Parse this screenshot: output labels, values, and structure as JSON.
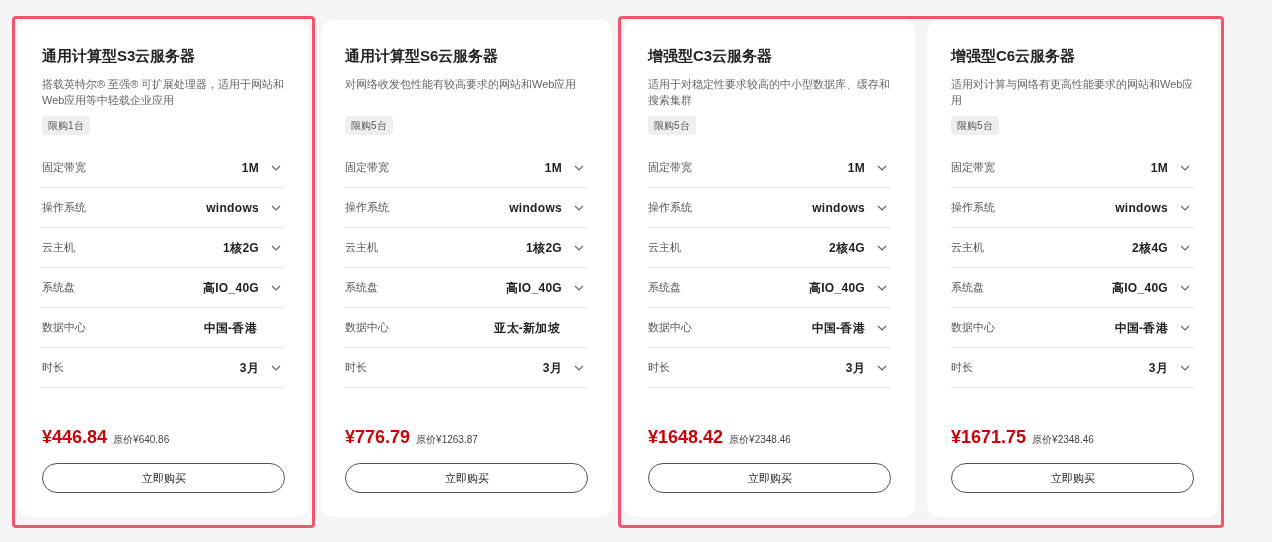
{
  "groups": [
    {
      "highlighted": true,
      "cards": [
        {
          "title": "通用计算型S3云服务器",
          "description": "搭载英特尔® 至强® 可扩展处理器，适用于网站和Web应用等中轻载企业应用",
          "limit": "限购1台",
          "specs": [
            {
              "label": "固定带宽",
              "value": "1M",
              "dropdown": true
            },
            {
              "label": "操作系统",
              "value": "windows",
              "dropdown": true
            },
            {
              "label": "云主机",
              "value": "1核2G",
              "dropdown": true
            },
            {
              "label": "系统盘",
              "value": "高IO_40G",
              "dropdown": true
            },
            {
              "label": "数据中心",
              "value": "中国-香港",
              "dropdown": false
            },
            {
              "label": "时长",
              "value": "3月",
              "dropdown": true
            }
          ],
          "price": "¥446.84",
          "original_price": "原价¥640.86",
          "button": "立即购买"
        }
      ]
    },
    {
      "highlighted": false,
      "cards": [
        {
          "title": "通用计算型S6云服务器",
          "description": "对网络收发包性能有较高要求的网站和Web应用",
          "limit": "限购5台",
          "specs": [
            {
              "label": "固定带宽",
              "value": "1M",
              "dropdown": true
            },
            {
              "label": "操作系统",
              "value": "windows",
              "dropdown": true
            },
            {
              "label": "云主机",
              "value": "1核2G",
              "dropdown": true
            },
            {
              "label": "系统盘",
              "value": "高IO_40G",
              "dropdown": true
            },
            {
              "label": "数据中心",
              "value": "亚太-新加坡",
              "dropdown": false
            },
            {
              "label": "时长",
              "value": "3月",
              "dropdown": true
            }
          ],
          "price": "¥776.79",
          "original_price": "原价¥1263.87",
          "button": "立即购买"
        }
      ]
    },
    {
      "highlighted": true,
      "cards": [
        {
          "title": "增强型C3云服务器",
          "description": "适用于对稳定性要求较高的中小型数据库、缓存和搜索集群",
          "limit": "限购5台",
          "specs": [
            {
              "label": "固定带宽",
              "value": "1M",
              "dropdown": true
            },
            {
              "label": "操作系统",
              "value": "windows",
              "dropdown": true
            },
            {
              "label": "云主机",
              "value": "2核4G",
              "dropdown": true
            },
            {
              "label": "系统盘",
              "value": "高IO_40G",
              "dropdown": true
            },
            {
              "label": "数据中心",
              "value": "中国-香港",
              "dropdown": true
            },
            {
              "label": "时长",
              "value": "3月",
              "dropdown": true
            }
          ],
          "price": "¥1648.42",
          "original_price": "原价¥2348.46",
          "button": "立即购买"
        },
        {
          "title": "增强型C6云服务器",
          "description": "适用对计算与网络有更高性能要求的网站和Web应用",
          "limit": "限购5台",
          "specs": [
            {
              "label": "固定带宽",
              "value": "1M",
              "dropdown": true
            },
            {
              "label": "操作系统",
              "value": "windows",
              "dropdown": true
            },
            {
              "label": "云主机",
              "value": "2核4G",
              "dropdown": true
            },
            {
              "label": "系统盘",
              "value": "高IO_40G",
              "dropdown": true
            },
            {
              "label": "数据中心",
              "value": "中国-香港",
              "dropdown": true
            },
            {
              "label": "时长",
              "value": "3月",
              "dropdown": true
            }
          ],
          "price": "¥1671.75",
          "original_price": "原价¥2348.46",
          "button": "立即购买"
        }
      ]
    }
  ]
}
